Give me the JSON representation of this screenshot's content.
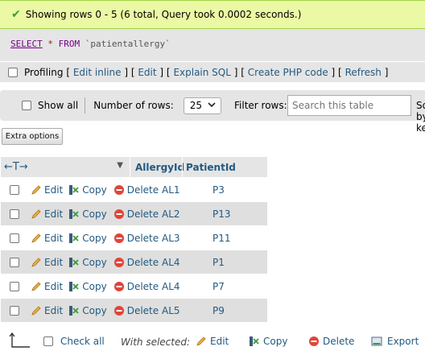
{
  "message": {
    "text": "Showing rows 0 - 5 (6 total, Query took 0.0002 seconds.)"
  },
  "sql": {
    "select": "SELECT",
    "star": "*",
    "from": "FROM",
    "table": "`patientallergy`"
  },
  "profiling": {
    "label": "Profiling",
    "open": "[",
    "sep": "] [",
    "close": "]",
    "links": [
      "Edit inline",
      "Edit",
      "Explain SQL",
      "Create PHP code",
      "Refresh"
    ]
  },
  "nav": {
    "show_all": "Show all",
    "rows_label": "Number of rows:",
    "rows_value": "25",
    "filter_label": "Filter rows:",
    "search_placeholder": "Search this table",
    "sort_label": "Sort by key:"
  },
  "extra_options": "Extra options",
  "table": {
    "columns": [
      "AllergyId",
      "PatientId"
    ],
    "row_actions": {
      "edit": "Edit",
      "copy": "Copy",
      "delete": "Delete"
    },
    "rows": [
      {
        "allergy": "AL1",
        "patient": "P3"
      },
      {
        "allergy": "AL2",
        "patient": "P13"
      },
      {
        "allergy": "AL3",
        "patient": "P11"
      },
      {
        "allergy": "AL4",
        "patient": "P1"
      },
      {
        "allergy": "AL4",
        "patient": "P7"
      },
      {
        "allergy": "AL5",
        "patient": "P9"
      }
    ]
  },
  "footer": {
    "check_all": "Check all",
    "with_selected": "With selected:",
    "edit": "Edit",
    "copy": "Copy",
    "delete": "Delete",
    "export": "Export"
  },
  "colors": {
    "success_bg": "#ebf8a4",
    "link": "#235a81",
    "row_alt": "#dfdfdf",
    "panel": "#e5e5e5"
  }
}
